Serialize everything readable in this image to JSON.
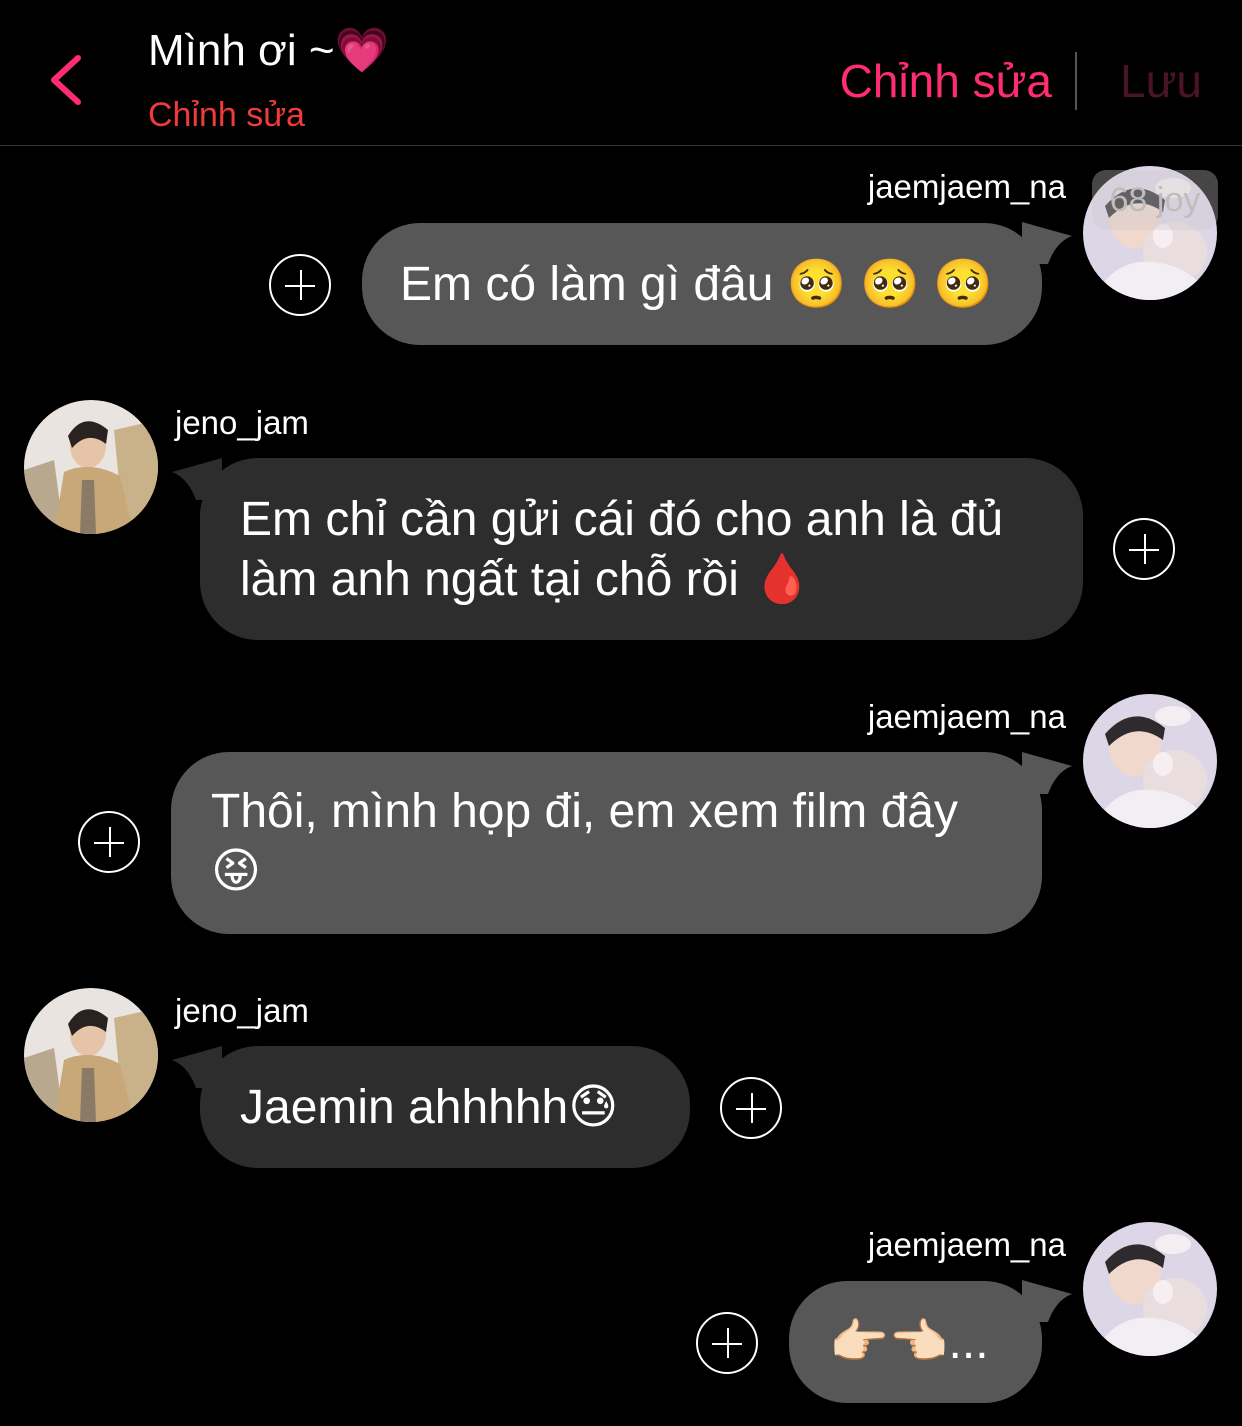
{
  "header": {
    "title": "Mình ơi ~💗",
    "subtitle": "Chỉnh sửa",
    "edit_label": "Chỉnh sửa",
    "save_label": "Lưu"
  },
  "badge": "68 joy",
  "messages": [
    {
      "sender": "jaemjaem_na",
      "side": "right",
      "text": "Em có làm gì đâu 🥺 🥺 🥺"
    },
    {
      "sender": "jeno_jam",
      "side": "left",
      "line1": "Em chỉ cần gửi cái đó cho anh là đủ",
      "line2": "làm anh ngất tại chỗ rồi 🩸"
    },
    {
      "sender": "jaemjaem_na",
      "side": "right",
      "line1": "Thôi, mình họp đi, em xem film đây",
      "line2": "😝"
    },
    {
      "sender": "jeno_jam",
      "side": "left",
      "text": "Jaemin ahhhhh😓"
    },
    {
      "sender": "jaemjaem_na",
      "side": "right",
      "text": "👉🏻👈🏻..."
    }
  ],
  "colors": {
    "accent": "#ff2d6f",
    "subtitle": "#ef3b3b",
    "save_disabled": "#4a1424",
    "bubble_right": "#575757",
    "bubble_left": "#2d2d2d"
  },
  "icons": [
    "chevron-left-icon",
    "plus-circle-icon"
  ]
}
